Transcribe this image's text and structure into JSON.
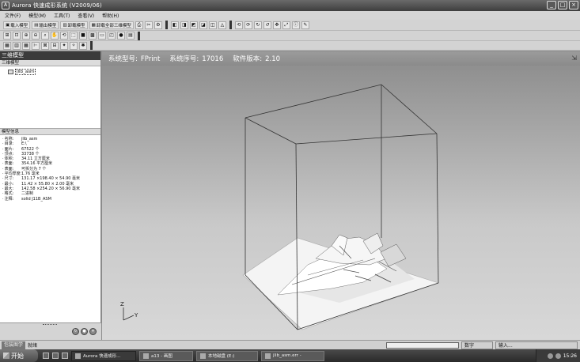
{
  "window": {
    "title": "Aurora 快速成形系统 (V2009/06)",
    "controls": [
      "_",
      "□",
      "×"
    ]
  },
  "menu": [
    "文件(F)",
    "模型(M)",
    "工具(T)",
    "查看(V)",
    "帮助(H)"
  ],
  "toolbar1": {
    "load_model": "载入模型",
    "export_model": "输出模型",
    "unload_model": "卸载模型",
    "unload_all": "卸载全部三维模型"
  },
  "left_panel": {
    "title": "三维模型",
    "tree_header": "三维模型",
    "tree_item": "jlib_asm",
    "info_header": "模型信息",
    "info": [
      {
        "k": "名称:",
        "v": "jlib_asm"
      },
      {
        "k": "目录:",
        "v": "E:\\"
      },
      {
        "k": "面片:",
        "v": "67522 个"
      },
      {
        "k": "顶点:",
        "v": "33738 个"
      },
      {
        "k": "体积:",
        "v": "34.11 立方厘米"
      },
      {
        "k": "表面:",
        "v": "354.16 平方厘米"
      },
      {
        "k": "表面:",
        "v": "可拆分为 7 个"
      },
      {
        "k": "平均厚度:",
        "v": "1.76 毫米"
      },
      {
        "k": "尺寸:",
        "v": "131.17 ×198.40 × 54.90 毫米"
      },
      {
        "k": "最小:",
        "v": "11.42 × 55.80 × 2.00 毫米"
      },
      {
        "k": "最大:",
        "v": "142.58 ×254.20 × 56.90 毫米"
      },
      {
        "k": "格式:",
        "v": "二进制"
      },
      {
        "k": "注释:",
        "v": "solid J11B_ASM"
      }
    ]
  },
  "viewport": {
    "system_model_label": "系统型号:",
    "system_model": "FPrint",
    "serial_label": "系统序号:",
    "serial": "17016",
    "version_label": "软件版本:",
    "version": "2.10",
    "axis_z": "Z",
    "axis_y": "Y"
  },
  "statusbar": {
    "tab": "包装图学",
    "status": "就绪",
    "num": "数字",
    "ime": "输入..."
  },
  "taskbar": {
    "start": "开始",
    "tasks": [
      "Aurora 快速成形...",
      "a13 - 画图",
      "本地磁盘 (E:)",
      "jlib_asm.err -"
    ],
    "clock": "15:26"
  },
  "colors": {
    "header_bg": "#8b8b8b",
    "panel_title_bg": "#3b3b3b",
    "taskbar_bg": "#2a2a2a"
  }
}
